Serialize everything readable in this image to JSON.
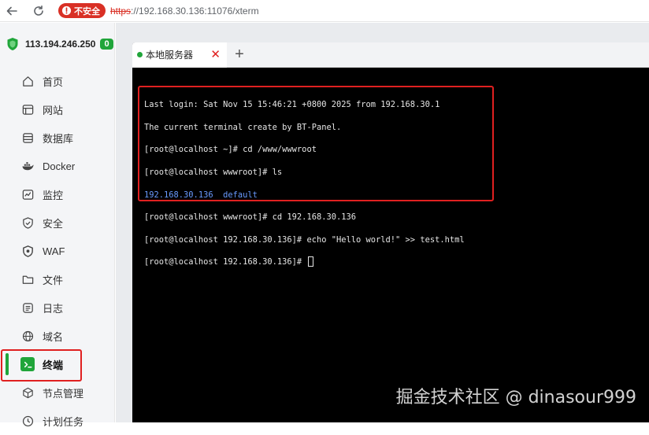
{
  "browser": {
    "security_label": "不安全",
    "url_scheme": "https",
    "url_rest": "://192.168.30.136:11076/xterm"
  },
  "server": {
    "ip": "113.194.246.250",
    "badge": "0"
  },
  "sidebar": {
    "items": [
      {
        "label": "首页",
        "icon": "home-icon"
      },
      {
        "label": "网站",
        "icon": "website-icon"
      },
      {
        "label": "数据库",
        "icon": "database-icon"
      },
      {
        "label": "Docker",
        "icon": "docker-icon"
      },
      {
        "label": "监控",
        "icon": "monitor-icon"
      },
      {
        "label": "安全",
        "icon": "security-shield-icon"
      },
      {
        "label": "WAF",
        "icon": "waf-icon"
      },
      {
        "label": "文件",
        "icon": "folder-icon"
      },
      {
        "label": "日志",
        "icon": "log-icon"
      },
      {
        "label": "域名",
        "icon": "globe-icon"
      },
      {
        "label": "终端",
        "icon": "terminal-icon",
        "active": true
      },
      {
        "label": "节点管理",
        "icon": "node-cube-icon"
      },
      {
        "label": "计划任务",
        "icon": "schedule-icon"
      }
    ]
  },
  "terminal": {
    "tab_label": "本地服务器",
    "close_symbol": "✕",
    "add_symbol": "+",
    "lines": [
      "Last login: Sat Nov 15 15:46:21 +0800 2025 from 192.168.30.1",
      "The current terminal create by BT-Panel.",
      "[root@localhost ~]# cd /www/wwwroot",
      "[root@localhost wwwroot]# ls",
      "",
      "[root@localhost wwwroot]# cd 192.168.30.136",
      "[root@localhost 192.168.30.136]# echo \"Hello world!\" >> test.html",
      "[root@localhost 192.168.30.136]# "
    ],
    "ls_output": "192.168.30.136  default"
  },
  "watermark": "掘金技术社区 @ dinasour999",
  "colors": {
    "accent": "#20a53a",
    "highlight": "#e02020",
    "insecure": "#d93025",
    "ls_dir": "#6a9bff"
  }
}
